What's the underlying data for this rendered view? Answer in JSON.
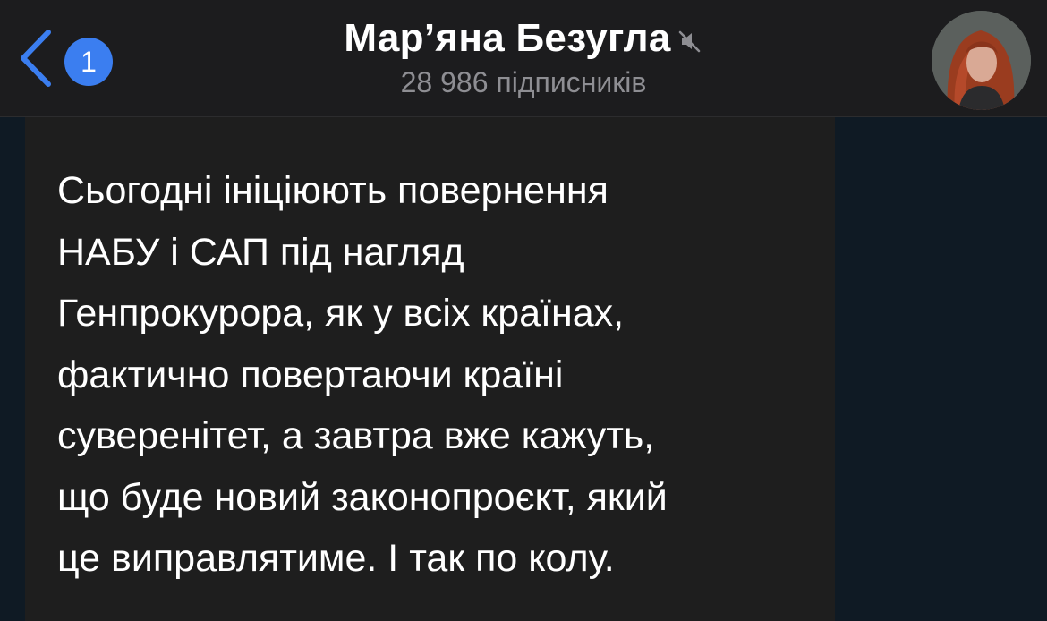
{
  "header": {
    "back_label": "Back",
    "unread_count": "1",
    "channel_name": "Мар’яна Безугла",
    "muted_icon": "speaker-muted-icon",
    "subscribers": "28 986 підписників",
    "avatar_icon": "channel-avatar"
  },
  "message": {
    "text": "Сьогодні ініціюють повернення\nНАБУ і САП під нагляд\nГенпрокурора, як у всіх країнах,\nфактично повертаючи країні\nсуверенітет, а завтра вже кажуть,\nщо буде новий законопроєкт, який\nце виправлятиме. І так по колу."
  },
  "colors": {
    "header_bg": "#1c1c1e",
    "accent": "#3b7ef0",
    "chat_bg": "#0f1a24",
    "bubble_bg": "#1e1e1e",
    "secondary_text": "#8e8e93"
  }
}
